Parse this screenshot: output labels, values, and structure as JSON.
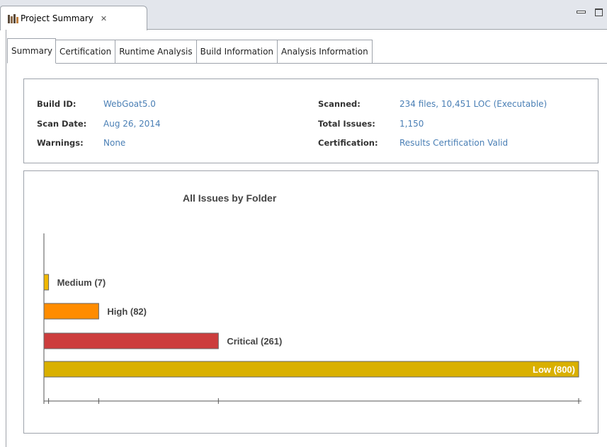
{
  "view": {
    "title": "Project Summary",
    "close_glyph": "✕"
  },
  "tabs": [
    {
      "label": "Summary",
      "active": true
    },
    {
      "label": "Certification",
      "active": false
    },
    {
      "label": "Runtime Analysis",
      "active": false
    },
    {
      "label": "Build Information",
      "active": false
    },
    {
      "label": "Analysis Information",
      "active": false
    }
  ],
  "info": {
    "build_id_label": "Build ID:",
    "build_id_value": "WebGoat5.0",
    "scan_date_label": "Scan Date:",
    "scan_date_value": "Aug 26, 2014",
    "warnings_label": "Warnings:",
    "warnings_value": "None",
    "scanned_label": "Scanned:",
    "scanned_value": "234 files, 10,451 LOC (Executable)",
    "total_issues_label": "Total Issues:",
    "total_issues_value": "1,150",
    "certification_label": "Certification:",
    "certification_value": "Results Certification Valid"
  },
  "colors": {
    "link": "#4a7fb5",
    "medium": "#f0b800",
    "high": "#ff8c00",
    "critical": "#cc3d3d",
    "low": "#d9b000"
  },
  "chart_data": {
    "type": "bar",
    "orientation": "horizontal",
    "title": "All Issues by Folder",
    "categories": [
      "Medium",
      "High",
      "Critical",
      "Low"
    ],
    "values": [
      7,
      82,
      261,
      800
    ],
    "labels": [
      "Medium (7)",
      "High (82)",
      "Critical (261)",
      "Low (800)"
    ],
    "colors": [
      "#f0b800",
      "#ff8c00",
      "#cc3d3d",
      "#d9b000"
    ],
    "xlim": [
      0,
      800
    ],
    "grid": false,
    "legend": "none"
  }
}
